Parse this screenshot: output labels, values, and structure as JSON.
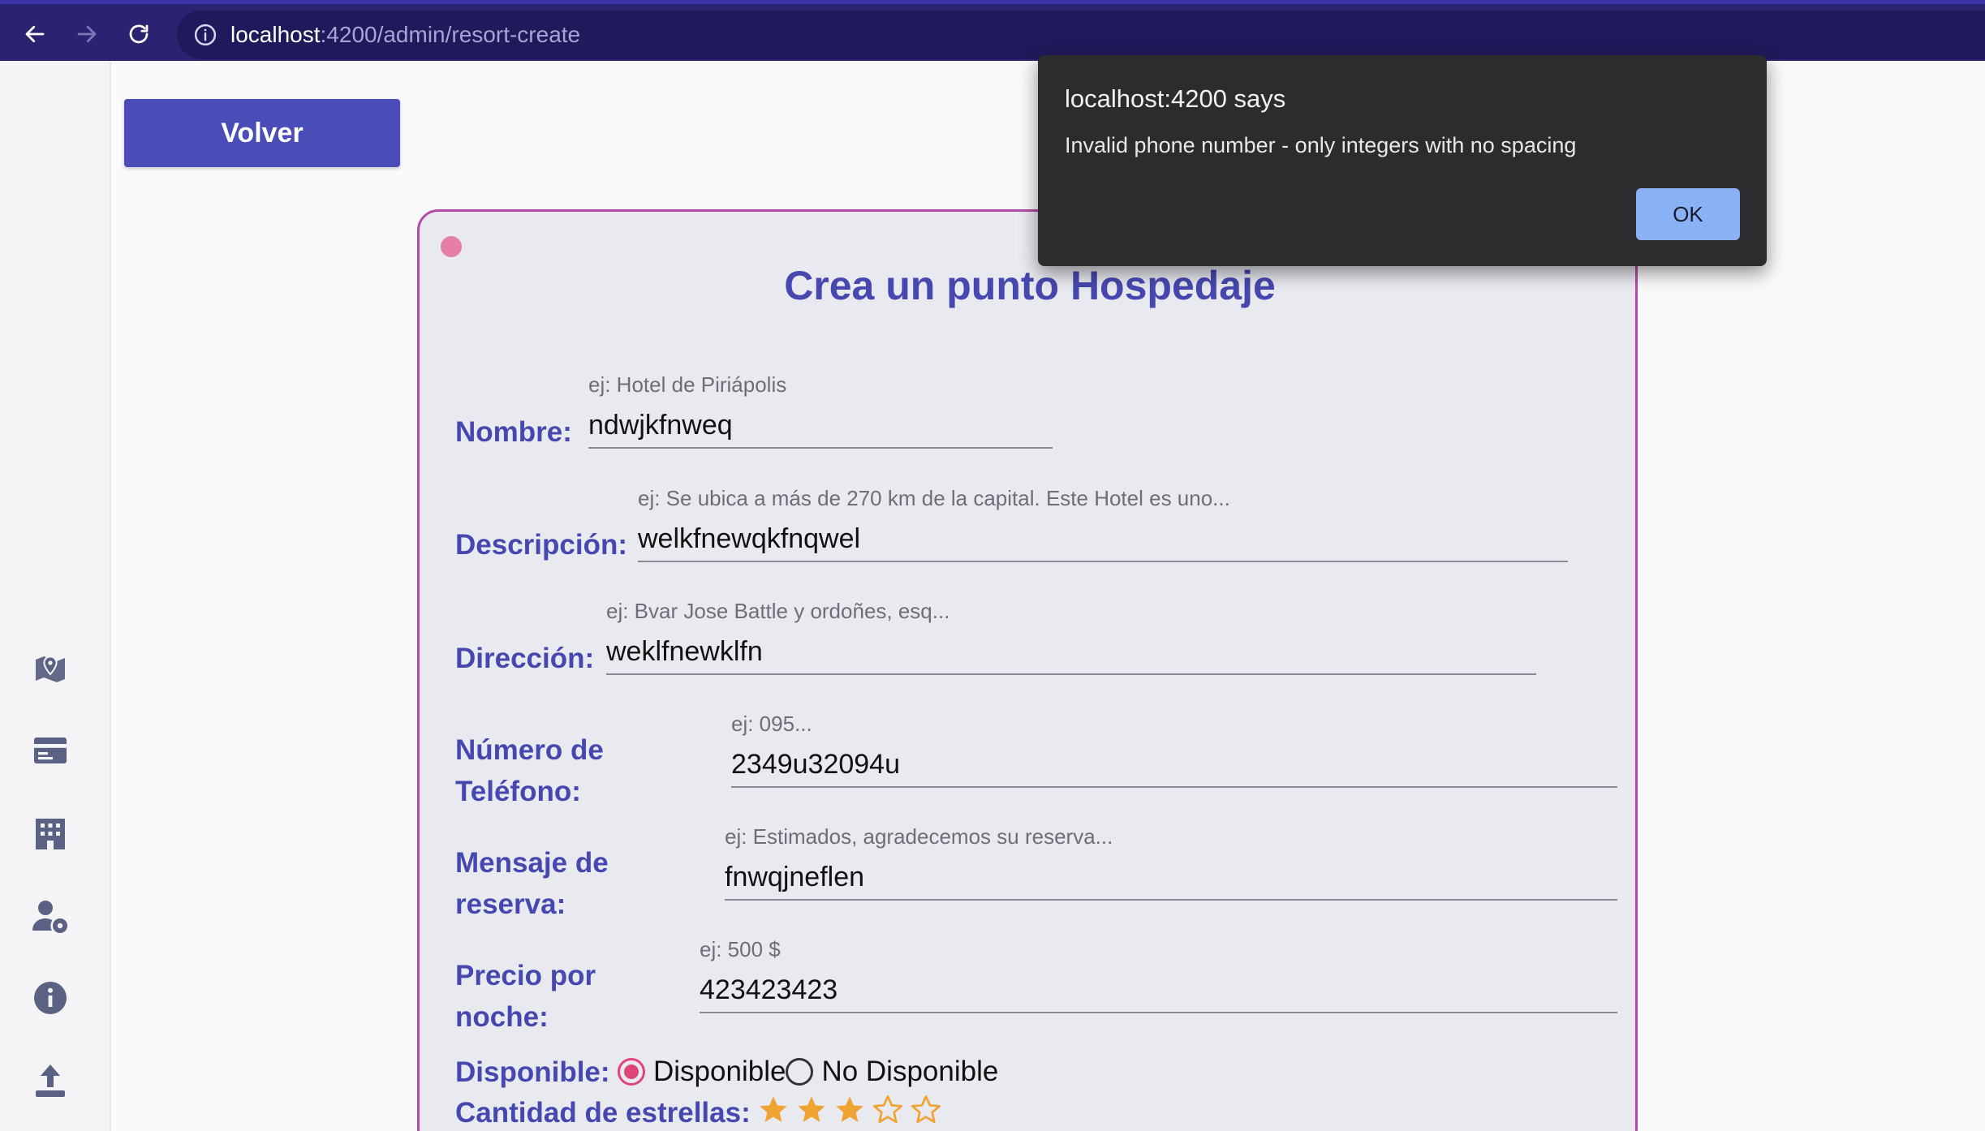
{
  "browser": {
    "url_host": "localhost",
    "url_rest": ":4200/admin/resort-create"
  },
  "sidebar": {
    "icons": [
      "map-icon",
      "card-icon",
      "building-icon",
      "user-settings-icon",
      "info-icon",
      "upload-icon"
    ]
  },
  "main": {
    "back_label": "Volver"
  },
  "form": {
    "title": "Crea un punto Hospedaje",
    "nombre": {
      "label": "Nombre:",
      "hint": "ej: Hotel de Piriápolis",
      "value": "ndwjkfnweq"
    },
    "descripcion": {
      "label": "Descripción:",
      "hint": "ej: Se ubica a más de 270 km de la capital. Este Hotel es uno...",
      "value": "welkfnewqkfnqwel"
    },
    "direccion": {
      "label": "Dirección:",
      "hint": "ej: Bvar Jose Battle y ordoñes, esq...",
      "value": "weklfnewklfn"
    },
    "telefono": {
      "label_line1": "Número de",
      "label_line2": "Teléfono:",
      "hint": "ej: 095...",
      "value": "2349u32094u"
    },
    "mensaje": {
      "label_line1": "Mensaje de",
      "label_line2": "reserva:",
      "hint": "ej: Estimados, agradecemos su reserva...",
      "value": "fnwqjneflen"
    },
    "precio": {
      "label_line1": "Precio por",
      "label_line2": "noche:",
      "hint": "ej: 500 $",
      "value": "423423423"
    },
    "disponible": {
      "label": "Disponible:",
      "options": [
        "Disponible",
        "No Disponible"
      ],
      "selected": "Disponible"
    },
    "estrellas": {
      "label": "Cantidad de estrellas:",
      "rating": 3,
      "max": 5
    }
  },
  "alert": {
    "title": "localhost:4200 says",
    "message": "Invalid phone number - only integers with no spacing",
    "ok_label": "OK"
  },
  "colors": {
    "accent": "#4648b0",
    "card_border": "#b44aa8",
    "star_fill": "#f0a232",
    "radio_selected": "#e0457a"
  }
}
